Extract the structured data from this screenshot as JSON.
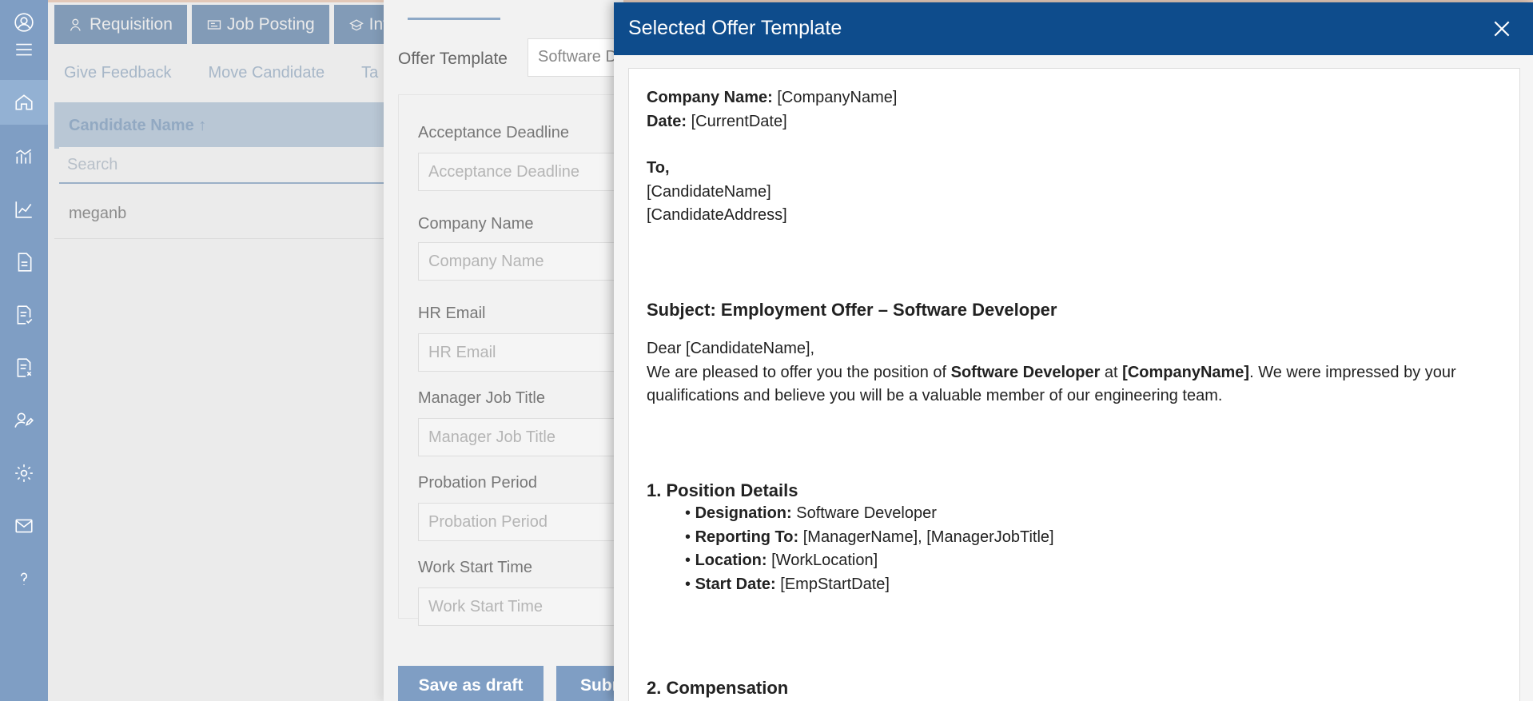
{
  "tabs": [
    {
      "label": "Requisition",
      "icon": "user-icon"
    },
    {
      "label": "Job Posting",
      "icon": "job-posting-icon"
    },
    {
      "label": "Int",
      "icon": "interview-icon"
    }
  ],
  "actions": [
    "Give Feedback",
    "Move Candidate",
    "Ta"
  ],
  "grid": {
    "header": "Candidate Name ↑",
    "search_placeholder": "Search",
    "rows": [
      "meganb"
    ]
  },
  "form": {
    "template_label": "Offer Template",
    "template_value": "Software D",
    "fields": [
      {
        "label": "Acceptance Deadline",
        "placeholder": "Acceptance Deadline"
      },
      {
        "label": "Company Name",
        "placeholder": "Company Name"
      },
      {
        "label": "HR Email",
        "placeholder": "HR Email"
      },
      {
        "label": "Manager Job Title",
        "placeholder": "Manager Job Title"
      },
      {
        "label": "Probation Period",
        "placeholder": "Probation Period"
      },
      {
        "label": "Work Start Time",
        "placeholder": "Work Start Time"
      }
    ],
    "save_draft_label": "Save as draft",
    "submit_label": "Subm"
  },
  "modal": {
    "title": "Selected Offer Template",
    "doc": {
      "company_label": "Company Name:",
      "company_value": "[CompanyName]",
      "date_label": "Date:",
      "date_value": "[CurrentDate]",
      "to_label": "To,",
      "candidate_name": "[CandidateName]",
      "candidate_address": "[CandidateAddress]",
      "subject": "Subject: Employment Offer – Software Developer",
      "greeting": "Dear [CandidateName],",
      "intro_pre": "We are pleased to offer you the position of ",
      "intro_role": "Software Developer",
      "intro_mid": " at ",
      "intro_company": "[CompanyName]",
      "intro_post": ". We were impressed by your qualifications and believe you will be a valuable member of our engineering team.",
      "section1": "1. Position Details",
      "details": [
        {
          "label": "Designation:",
          "value": " Software Developer"
        },
        {
          "label": "Reporting To:",
          "value": " [ManagerName], [ManagerJobTitle]"
        },
        {
          "label": "Location:",
          "value": " [WorkLocation]"
        },
        {
          "label": "Start Date:",
          "value": " [EmpStartDate]"
        }
      ],
      "section2": "2. Compensation"
    }
  },
  "colors": {
    "rail": "#7f9ec4",
    "modal_header": "#0e4c8c",
    "tab": "#8ea9c7"
  }
}
